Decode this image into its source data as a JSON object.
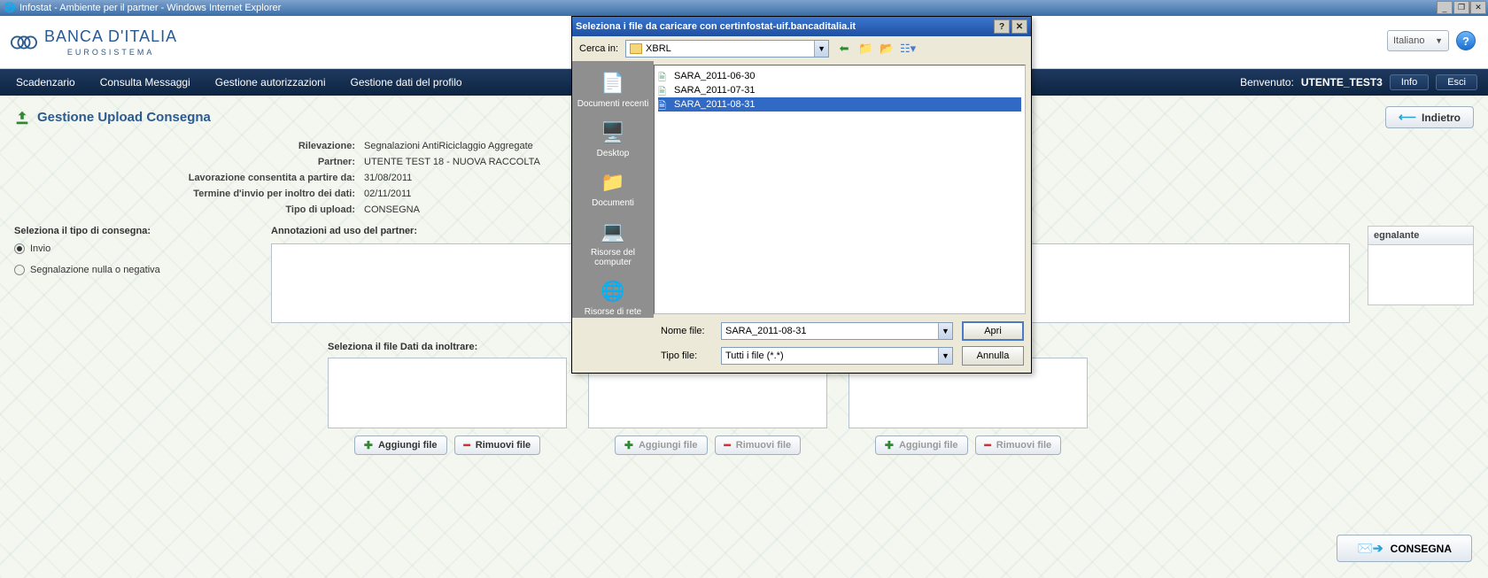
{
  "ie": {
    "title": "Infostat - Ambiente per il partner - Windows Internet Explorer"
  },
  "brand": {
    "name": "BANCA D'ITALIA",
    "sub": "EUROSISTEMA",
    "lang": "Italiano",
    "help": "?"
  },
  "nav": {
    "items": [
      "Scadenzario",
      "Consulta Messaggi",
      "Gestione autorizzazioni",
      "Gestione dati del profilo"
    ],
    "welcome": "Benvenuto:",
    "user": "UTENTE_TEST3",
    "info_btn": "Info",
    "exit_btn": "Esci"
  },
  "page": {
    "title": "Gestione Upload Consegna",
    "back_btn": "Indietro"
  },
  "info": {
    "rows": [
      {
        "label": "Rilevazione:",
        "value": "Segnalazioni AntiRiciclaggio Aggregate"
      },
      {
        "label": "Partner:",
        "value": "UTENTE TEST 18 - NUOVA RACCOLTA"
      },
      {
        "label": "Lavorazione consentita a partire da:",
        "value": "31/08/2011"
      },
      {
        "label": "Termine d'invio per inoltro dei dati:",
        "value": "02/11/2011"
      },
      {
        "label": "Tipo di upload:",
        "value": "CONSEGNA"
      }
    ]
  },
  "delivery": {
    "section_title": "Seleziona il tipo di consegna:",
    "opt_invio": "Invio",
    "opt_null": "Segnalazione nulla o negativa",
    "selected": "Invio"
  },
  "annot": {
    "title": "Annotazioni ad uso del partner:",
    "value": ""
  },
  "segnalante": {
    "header": "egnalante"
  },
  "filesec": {
    "label": "Seleziona il file Dati da inoltrare:",
    "add": "Aggiungi file",
    "remove": "Rimuovi file"
  },
  "consegna_btn": "CONSEGNA",
  "dialog": {
    "title": "Seleziona i file da caricare con certinfostat-uif.bancaditalia.it",
    "search_in_lbl": "Cerca in:",
    "folder": "XBRL",
    "places": [
      {
        "label": "Documenti recenti"
      },
      {
        "label": "Desktop"
      },
      {
        "label": "Documenti"
      },
      {
        "label": "Risorse del computer"
      },
      {
        "label": "Risorse di rete"
      }
    ],
    "files": [
      {
        "name": "SARA_2011-06-30",
        "selected": false
      },
      {
        "name": "SARA_2011-07-31",
        "selected": false
      },
      {
        "name": "SARA_2011-08-31",
        "selected": true
      }
    ],
    "filename_lbl": "Nome file:",
    "filename_val": "SARA_2011-08-31",
    "filetype_lbl": "Tipo file:",
    "filetype_val": "Tutti i file (*.*)",
    "open_btn": "Apri",
    "cancel_btn": "Annulla"
  }
}
